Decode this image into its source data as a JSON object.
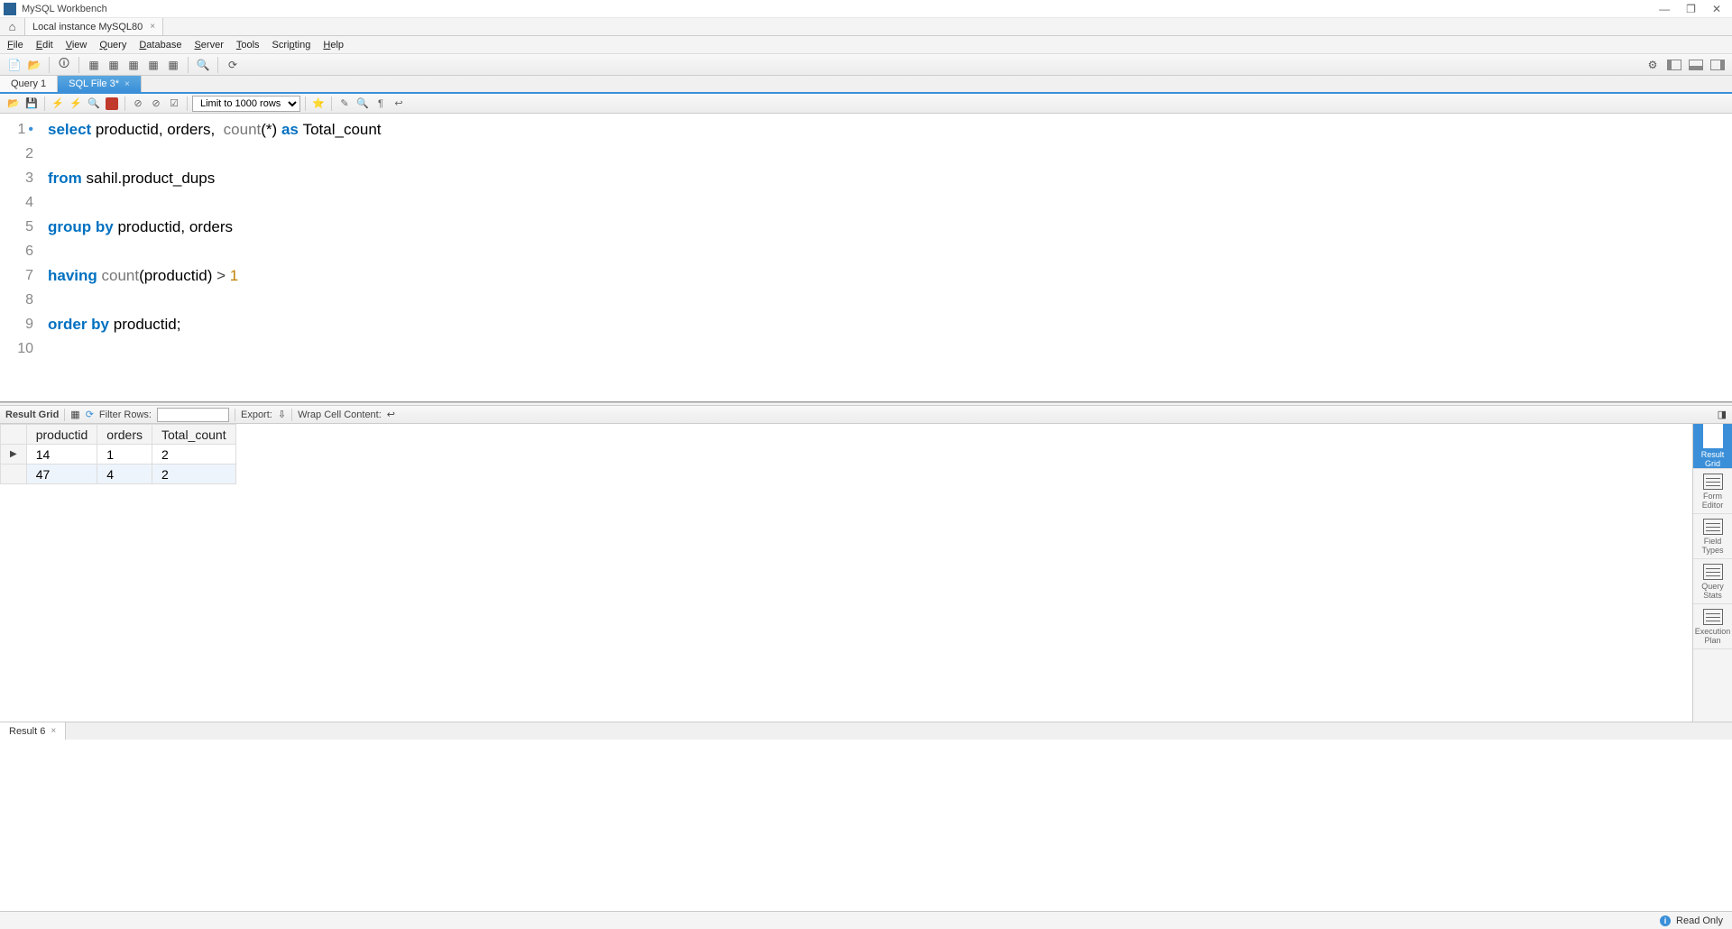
{
  "app": {
    "title": "MySQL Workbench"
  },
  "connection_tab": {
    "label": "Local instance MySQL80"
  },
  "menu": {
    "file": "File",
    "edit": "Edit",
    "view": "View",
    "query": "Query",
    "database": "Database",
    "server": "Server",
    "tools": "Tools",
    "scripting": "Scripting",
    "help": "Help"
  },
  "query_tabs": {
    "tab1": "Query 1",
    "tab2": "SQL File 3*"
  },
  "editor_toolbar": {
    "limit_rows": "Limit to 1000 rows"
  },
  "code": {
    "lines": [
      "1",
      "2",
      "3",
      "4",
      "5",
      "6",
      "7",
      "8",
      "9",
      "10"
    ],
    "l1_select": "select",
    "l1_cols": " productid, orders,  ",
    "l1_count": "count",
    "l1_star": "(*)",
    "l1_as": " as ",
    "l1_alias": "Total_count",
    "l3_from": "from",
    "l3_tbl": " sahil.product_dups",
    "l5_group": "group by",
    "l5_cols": " productid, orders",
    "l7_having": "having",
    "l7_count": " count",
    "l7_args": "(productid) ",
    "l7_op": "> ",
    "l7_num": "1",
    "l9_order": "order by",
    "l9_col": " productid;"
  },
  "result_toolbar": {
    "result_grid": "Result Grid",
    "filter_rows": "Filter Rows:",
    "export": "Export:",
    "wrap": "Wrap Cell Content:"
  },
  "grid": {
    "columns": [
      "productid",
      "orders",
      "Total_count"
    ],
    "rows": [
      {
        "productid": "14",
        "orders": "1",
        "total": "2"
      },
      {
        "productid": "47",
        "orders": "4",
        "total": "2"
      }
    ]
  },
  "sidepanel": {
    "result_grid": "Result Grid",
    "form_editor": "Form Editor",
    "field_types": "Field Types",
    "query_stats": "Query Stats",
    "execution_plan": "Execution Plan"
  },
  "result_tab": {
    "label": "Result 6"
  },
  "status": {
    "read_only": "Read Only"
  }
}
